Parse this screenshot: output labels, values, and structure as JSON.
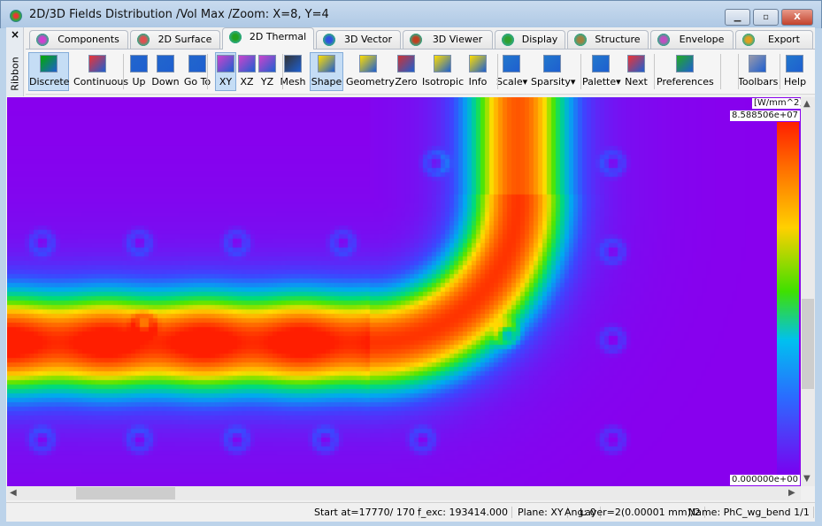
{
  "window": {
    "title": "2D/3D Fields Distribution /Vol Max /Zoom: X=8, Y=4",
    "minimize": "▁",
    "maximize": "▫",
    "close": "X"
  },
  "ribbon": {
    "close": "×",
    "label": "Ribbon"
  },
  "tabs": [
    {
      "label": "Components",
      "icon": "components-icon"
    },
    {
      "label": "2D Surface",
      "icon": "surface-icon"
    },
    {
      "label": "2D Thermal",
      "icon": "thermal-icon",
      "active": true
    },
    {
      "label": "3D Vector",
      "icon": "vector-icon"
    },
    {
      "label": "3D Viewer",
      "icon": "viewer-icon"
    },
    {
      "label": "Display",
      "icon": "display-icon"
    },
    {
      "label": "Structure",
      "icon": "structure-icon"
    },
    {
      "label": "Envelope",
      "icon": "envelope-icon"
    },
    {
      "label": "Export",
      "icon": "export-icon"
    }
  ],
  "toolbar": [
    {
      "label": "Discrete",
      "active": true
    },
    {
      "label": "Continuous"
    },
    {
      "label": "Up"
    },
    {
      "label": "Down"
    },
    {
      "label": "Go To"
    },
    {
      "label": "XY",
      "active": true
    },
    {
      "label": "XZ"
    },
    {
      "label": "YZ"
    },
    {
      "label": "Mesh"
    },
    {
      "label": "Shape",
      "active": true
    },
    {
      "label": "Geometry"
    },
    {
      "label": "Zero"
    },
    {
      "label": "Isotropic"
    },
    {
      "label": "Info"
    },
    {
      "label": "Scale▾"
    },
    {
      "label": "Sparsity▾"
    },
    {
      "label": "Palette▾"
    },
    {
      "label": "Next"
    },
    {
      "label": "Preferences"
    },
    {
      "label": "Toolbars"
    },
    {
      "label": "Help"
    }
  ],
  "colorbar": {
    "unit": "[W/mm^2]",
    "max": "8.588506e+07",
    "min": "0.000000e+00"
  },
  "status": [
    "Start at=17770/ 170",
    "f_exc: 193414.000",
    "Plane: XY",
    "Ang:   0",
    "Layer=2(0.00001 mm)/2",
    "Name: PhC_wg_bend 1/1"
  ]
}
